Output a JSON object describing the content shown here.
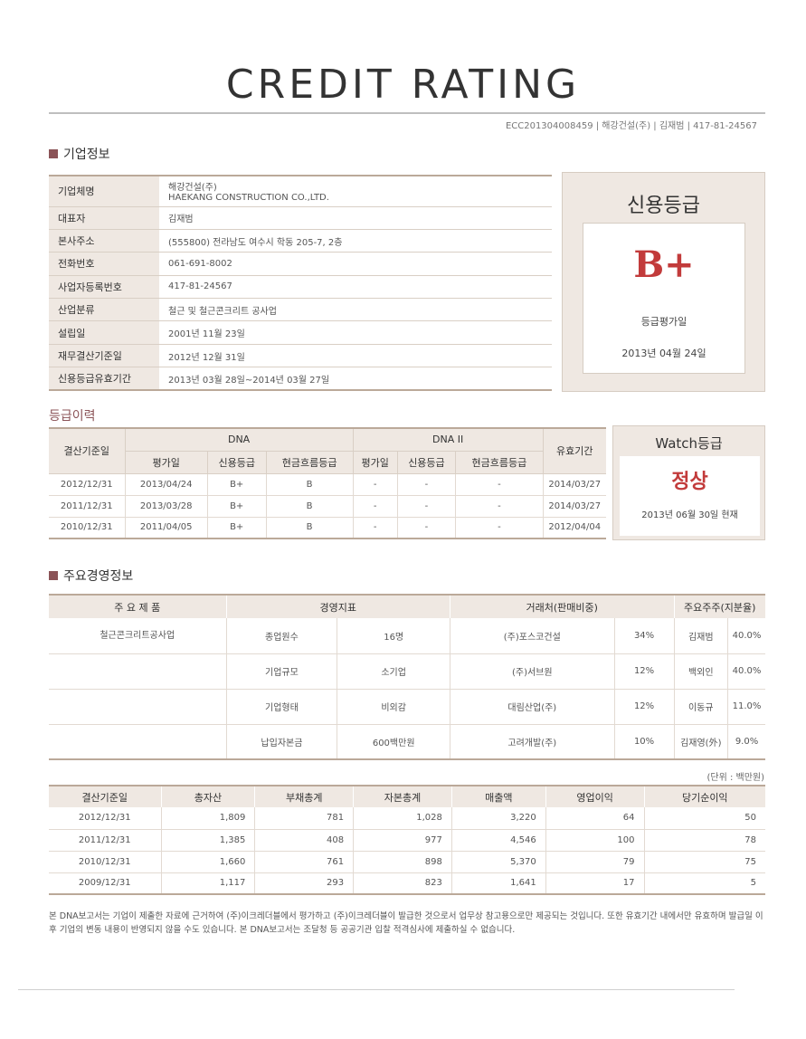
{
  "title": "CREDIT RATING",
  "ref_line": "ECC201304008459 | 해강건설(주) | 김재범 | 417-81-24567",
  "company_section": {
    "heading": "기업정보",
    "rows": [
      {
        "label": "기업체명",
        "value": "해강건설(주)",
        "value2": "HAEKANG CONSTRUCTION CO.,LTD."
      },
      {
        "label": "대표자",
        "value": "김재범"
      },
      {
        "label": "본사주소",
        "value": "(555800) 전라남도 여수시 학동 205-7, 2층"
      },
      {
        "label": "전화번호",
        "value": "061-691-8002"
      },
      {
        "label": "사업자등록번호",
        "value": "417-81-24567"
      },
      {
        "label": "산업분류",
        "value": "철근 및 철근콘크리트 공사업"
      },
      {
        "label": "설립일",
        "value": "2001년 11월 23일"
      },
      {
        "label": "재무결산기준일",
        "value": "2012년 12월 31일"
      },
      {
        "label": "신용등급유효기간",
        "value": "2013년 03월 28일~2014년 03월 27일"
      }
    ]
  },
  "grade_box": {
    "title": "신용등급",
    "grade": "B+",
    "label": "등급평가일",
    "date": "2013년 04월 24일"
  },
  "history": {
    "heading": "등급이력",
    "col_base": "결산기준일",
    "group1": "DNA",
    "group2": "DNA II",
    "col_valid": "유효기간",
    "sub_eval": "평가일",
    "sub_grade": "신용등급",
    "sub_cash": "현금흐름등급",
    "rows": [
      {
        "base": "2012/12/31",
        "eval1": "2013/04/24",
        "grade1": "B+",
        "cash1": "B",
        "eval2": "-",
        "grade2": "-",
        "cash2": "-",
        "valid": "2014/03/27"
      },
      {
        "base": "2011/12/31",
        "eval1": "2013/03/28",
        "grade1": "B+",
        "cash1": "B",
        "eval2": "-",
        "grade2": "-",
        "cash2": "-",
        "valid": "2014/03/27"
      },
      {
        "base": "2010/12/31",
        "eval1": "2011/04/05",
        "grade1": "B+",
        "cash1": "B",
        "eval2": "-",
        "grade2": "-",
        "cash2": "-",
        "valid": "2012/04/04"
      }
    ]
  },
  "watch_box": {
    "title": "Watch등급",
    "status": "정상",
    "date": "2013년 06월 30일 현재"
  },
  "management": {
    "heading": "주요경영정보",
    "h_product": "주 요 제 품",
    "h_indicator": "경영지표",
    "h_trade": "거래처(판매비중)",
    "h_share": "주요주주(지분율)",
    "product": "철근콘크리트공사업",
    "rows": [
      {
        "ind_label": "종업원수",
        "ind_value": "16명",
        "trade_name": "(주)포스코건설",
        "trade_pct": "34%",
        "share_name": "김재범",
        "share_pct": "40.0%"
      },
      {
        "ind_label": "기업규모",
        "ind_value": "소기업",
        "trade_name": "(주)서브원",
        "trade_pct": "12%",
        "share_name": "백외인",
        "share_pct": "40.0%"
      },
      {
        "ind_label": "기업형태",
        "ind_value": "비외감",
        "trade_name": "대림산업(주)",
        "trade_pct": "12%",
        "share_name": "이동규",
        "share_pct": "11.0%"
      },
      {
        "ind_label": "납입자본금",
        "ind_value": "600백만원",
        "trade_name": "고려개발(주)",
        "trade_pct": "10%",
        "share_name": "김재영(外)",
        "share_pct": "9.0%"
      }
    ]
  },
  "financial": {
    "unit": "(단위 : 백만원)",
    "headers": [
      "결산기준일",
      "총자산",
      "부채총계",
      "자본총계",
      "매출액",
      "영업이익",
      "당기순이익"
    ],
    "rows": [
      [
        "2012/12/31",
        "1,809",
        "781",
        "1,028",
        "3,220",
        "64",
        "50"
      ],
      [
        "2011/12/31",
        "1,385",
        "408",
        "977",
        "4,546",
        "100",
        "78"
      ],
      [
        "2010/12/31",
        "1,660",
        "761",
        "898",
        "5,370",
        "79",
        "75"
      ],
      [
        "2009/12/31",
        "1,117",
        "293",
        "823",
        "1,641",
        "17",
        "5"
      ]
    ]
  },
  "disclaimer": "본 DNA보고서는 기업이 제출한 자료에 근거하여 (주)이크레더블에서 평가하고 (주)이크레더블이 발급한 것으로서 업무상 참고용으로만 제공되는 것입니다. 또한 유효기간 내에서만 유효하며 발급일 이후 기업의 변동 내용이 반영되지 않을 수도 있습니다. 본 DNA보고서는 조달청 등 공공기관 입찰 적격심사에 제출하실 수 없습니다."
}
